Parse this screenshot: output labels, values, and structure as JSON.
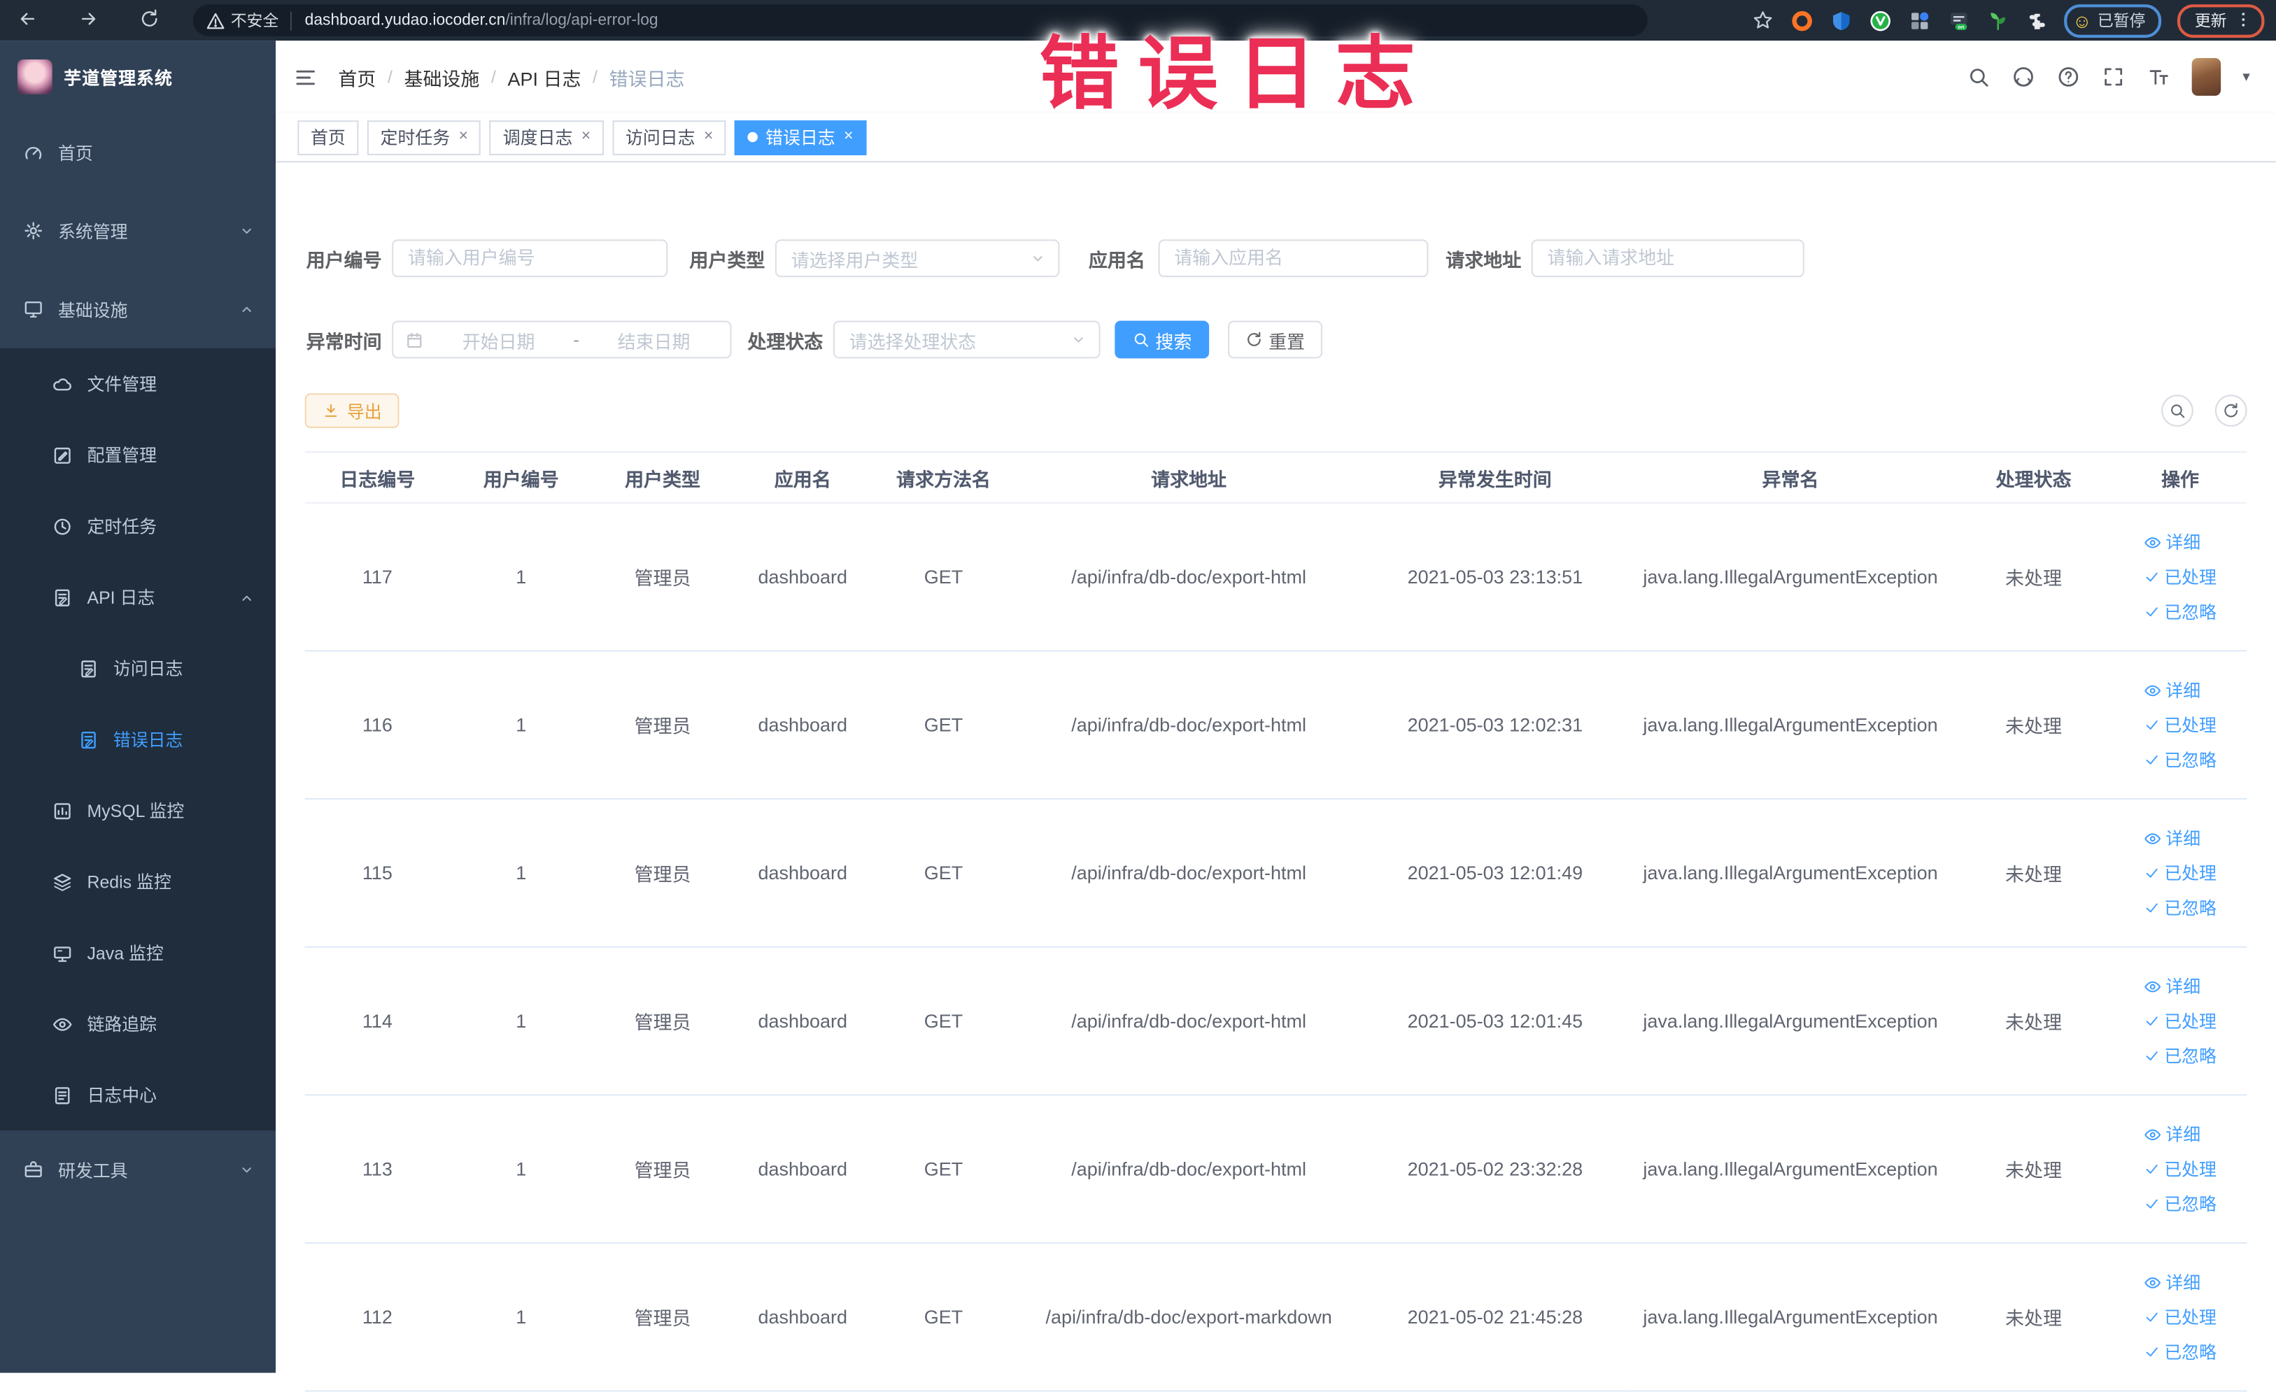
{
  "annotation": {
    "text": "错误日志"
  },
  "browser": {
    "security_label": "不安全",
    "url_domain": "dashboard.yudao.iocoder.cn",
    "url_path": "/infra/log/api-error-log",
    "nav_icons": [
      "back-icon",
      "forward-icon",
      "reload-icon",
      "home-icon"
    ],
    "extension_icons": [
      "star-icon",
      "ext-orange-icon",
      "ext-shield-icon",
      "ext-green-v-icon",
      "ext-grid-icon",
      "ext-on-icon",
      "ext-plant-icon",
      "ext-puzzle-icon"
    ],
    "paused_chip": "已暂停",
    "update_button": "更新"
  },
  "sidebar": {
    "title": "芋道管理系统",
    "items": [
      {
        "id": "home",
        "label": "首页",
        "icon": "gauge-icon",
        "level": 1,
        "sub": false,
        "chevron": "",
        "active": false
      },
      {
        "id": "system",
        "label": "系统管理",
        "icon": "gear-icon",
        "level": 1,
        "sub": false,
        "chevron": "down",
        "active": false
      },
      {
        "id": "infra",
        "label": "基础设施",
        "icon": "monitor-icon",
        "level": 1,
        "sub": false,
        "chevron": "up",
        "active": false
      },
      {
        "id": "file",
        "label": "文件管理",
        "icon": "cloud-icon",
        "level": 2,
        "sub": true,
        "chevron": "",
        "active": false
      },
      {
        "id": "config",
        "label": "配置管理",
        "icon": "edit-icon",
        "level": 2,
        "sub": true,
        "chevron": "",
        "active": false
      },
      {
        "id": "job",
        "label": "定时任务",
        "icon": "clock-icon",
        "level": 2,
        "sub": true,
        "chevron": "",
        "active": false
      },
      {
        "id": "api-log",
        "label": "API 日志",
        "icon": "doc-edit-icon",
        "level": 2,
        "sub": true,
        "chevron": "up",
        "active": false
      },
      {
        "id": "access-log",
        "label": "访问日志",
        "icon": "doc-edit-icon",
        "level": 3,
        "sub": true,
        "chevron": "",
        "active": false
      },
      {
        "id": "error-log",
        "label": "错误日志",
        "icon": "doc-edit-icon",
        "level": 3,
        "sub": true,
        "chevron": "",
        "active": true
      },
      {
        "id": "mysql",
        "label": "MySQL 监控",
        "icon": "chart-icon",
        "level": 2,
        "sub": true,
        "chevron": "",
        "active": false
      },
      {
        "id": "redis",
        "label": "Redis 监控",
        "icon": "layers-icon",
        "level": 2,
        "sub": true,
        "chevron": "",
        "active": false
      },
      {
        "id": "java",
        "label": "Java 监控",
        "icon": "screen-icon",
        "level": 2,
        "sub": true,
        "chevron": "",
        "active": false
      },
      {
        "id": "trace",
        "label": "链路追踪",
        "icon": "eye-icon",
        "level": 2,
        "sub": true,
        "chevron": "",
        "active": false
      },
      {
        "id": "log-center",
        "label": "日志中心",
        "icon": "doc-icon",
        "level": 2,
        "sub": true,
        "chevron": "",
        "active": false
      },
      {
        "id": "dev-tools",
        "label": "研发工具",
        "icon": "toolbox-icon",
        "level": 1,
        "sub": false,
        "chevron": "down",
        "active": false
      }
    ]
  },
  "navbar": {
    "breadcrumb": [
      "首页",
      "基础设施",
      "API 日志",
      "错误日志"
    ],
    "right_icons": [
      "search-icon",
      "github-icon",
      "question-icon",
      "fullscreen-icon",
      "text-size-icon"
    ]
  },
  "tabs": [
    {
      "label": "首页",
      "closable": false,
      "active": false
    },
    {
      "label": "定时任务",
      "closable": true,
      "active": false
    },
    {
      "label": "调度日志",
      "closable": true,
      "active": false
    },
    {
      "label": "访问日志",
      "closable": true,
      "active": false
    },
    {
      "label": "错误日志",
      "closable": true,
      "active": true
    }
  ],
  "filters": {
    "user_id": {
      "label": "用户编号",
      "placeholder": "请输入用户编号"
    },
    "user_type": {
      "label": "用户类型",
      "placeholder": "请选择用户类型"
    },
    "app_name": {
      "label": "应用名",
      "placeholder": "请输入应用名"
    },
    "request_url": {
      "label": "请求地址",
      "placeholder": "请输入请求地址"
    },
    "exception_time": {
      "label": "异常时间",
      "start_placeholder": "开始日期",
      "separator": "-",
      "end_placeholder": "结束日期"
    },
    "process_status": {
      "label": "处理状态",
      "placeholder": "请选择处理状态"
    },
    "search_button": "搜索",
    "reset_button": "重置"
  },
  "toolbar": {
    "export_label": "导出"
  },
  "table": {
    "columns": [
      "日志编号",
      "用户编号",
      "用户类型",
      "应用名",
      "请求方法名",
      "请求地址",
      "异常发生时间",
      "异常名",
      "处理状态",
      "操作"
    ],
    "actions": [
      {
        "label": "详细",
        "icon": "eye-small-icon"
      },
      {
        "label": "已处理",
        "icon": "check-icon"
      },
      {
        "label": "已忽略",
        "icon": "check-icon"
      }
    ],
    "rows": [
      {
        "log_id": "117",
        "user_id": "1",
        "user_type": "管理员",
        "app_name": "dashboard",
        "method": "GET",
        "url": "/api/infra/db-doc/export-html",
        "time": "2021-05-03 23:13:51",
        "exception": "java.lang.IllegalArgumentException",
        "status": "未处理"
      },
      {
        "log_id": "116",
        "user_id": "1",
        "user_type": "管理员",
        "app_name": "dashboard",
        "method": "GET",
        "url": "/api/infra/db-doc/export-html",
        "time": "2021-05-03 12:02:31",
        "exception": "java.lang.IllegalArgumentException",
        "status": "未处理"
      },
      {
        "log_id": "115",
        "user_id": "1",
        "user_type": "管理员",
        "app_name": "dashboard",
        "method": "GET",
        "url": "/api/infra/db-doc/export-html",
        "time": "2021-05-03 12:01:49",
        "exception": "java.lang.IllegalArgumentException",
        "status": "未处理"
      },
      {
        "log_id": "114",
        "user_id": "1",
        "user_type": "管理员",
        "app_name": "dashboard",
        "method": "GET",
        "url": "/api/infra/db-doc/export-html",
        "time": "2021-05-03 12:01:45",
        "exception": "java.lang.IllegalArgumentException",
        "status": "未处理"
      },
      {
        "log_id": "113",
        "user_id": "1",
        "user_type": "管理员",
        "app_name": "dashboard",
        "method": "GET",
        "url": "/api/infra/db-doc/export-html",
        "time": "2021-05-02 23:32:28",
        "exception": "java.lang.IllegalArgumentException",
        "status": "未处理"
      },
      {
        "log_id": "112",
        "user_id": "1",
        "user_type": "管理员",
        "app_name": "dashboard",
        "method": "GET",
        "url": "/api/infra/db-doc/export-markdown",
        "time": "2021-05-02 21:45:28",
        "exception": "java.lang.IllegalArgumentException",
        "status": "未处理"
      }
    ]
  },
  "colors": {
    "accent": "#409eff",
    "sidebar_bg": "#304156",
    "sidebar_sub_bg": "#1f2d3d",
    "annotation_red": "#eb2e55",
    "export_warning": "#e6a23c",
    "chrome_bar": "#212b38"
  }
}
